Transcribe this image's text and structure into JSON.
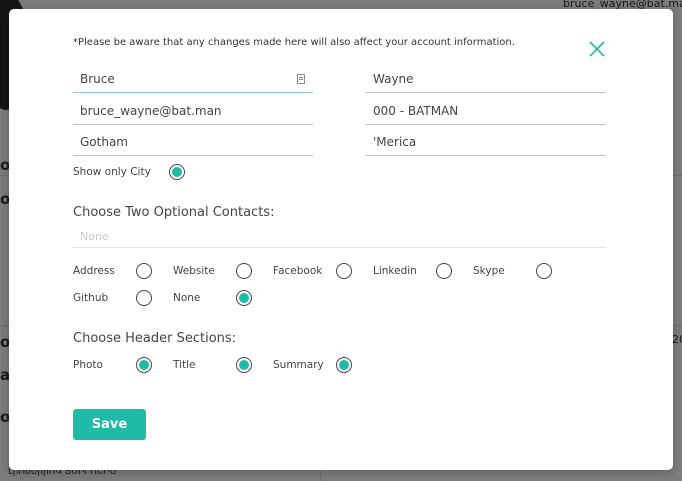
{
  "background": {
    "email": "bruce_wayne@bat.man",
    "fragments": [
      "o",
      "o",
      "o",
      "a",
      "o",
      "20",
      "ԼրՈծՍրրՈԿ ՅՍԻՐՈՆԻՍ"
    ]
  },
  "modal": {
    "notice": "*Please be aware that any changes made here will also affect your account information.",
    "close_icon": "close-icon",
    "fields": {
      "first_name": "Bruce",
      "last_name": "Wayne",
      "email": "bruce_wayne@bat.man",
      "phone": "000 - BATMAN",
      "city": "Gotham",
      "country": "'Merica"
    },
    "show_only_city": {
      "label": "Show only City",
      "checked": true
    },
    "optional_contacts": {
      "title": "Choose Two Optional Contacts:",
      "placeholder": "None",
      "options": [
        {
          "label": "Address",
          "checked": false
        },
        {
          "label": "Website",
          "checked": false
        },
        {
          "label": "Facebook",
          "checked": false
        },
        {
          "label": "Linkedin",
          "checked": false
        },
        {
          "label": "Skype",
          "checked": false
        },
        {
          "label": "Github",
          "checked": false
        },
        {
          "label": "None",
          "checked": true
        }
      ]
    },
    "header_sections": {
      "title": "Choose Header Sections:",
      "options": [
        {
          "label": "Photo",
          "checked": true
        },
        {
          "label": "Title",
          "checked": true
        },
        {
          "label": "Summary",
          "checked": true
        }
      ]
    },
    "save_label": "Save",
    "accent_color": "#1fbba6"
  }
}
